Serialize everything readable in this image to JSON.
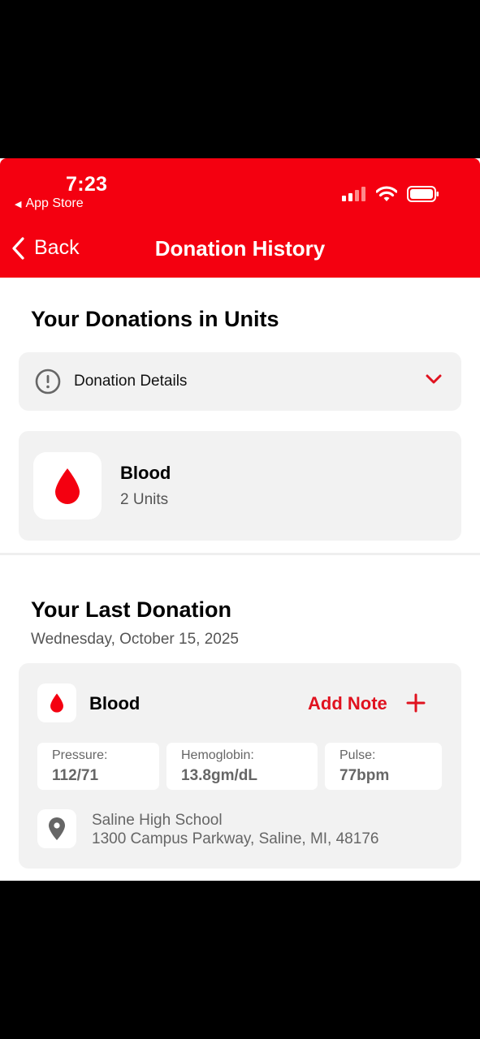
{
  "status_bar": {
    "time": "7:23",
    "back_app": "App Store"
  },
  "nav": {
    "back_label": "Back",
    "title": "Donation History"
  },
  "units_section": {
    "title": "Your Donations in Units",
    "details_label": "Donation Details",
    "item": {
      "type": "Blood",
      "units": "2 Units"
    }
  },
  "last_donation": {
    "title": "Your Last Donation",
    "date": "Wednesday, October 15, 2025",
    "type": "Blood",
    "add_note_label": "Add Note",
    "metrics": [
      {
        "label": "Pressure:",
        "value": "112/71"
      },
      {
        "label": "Hemoglobin:",
        "value": "13.8gm/dL"
      },
      {
        "label": "Pulse:",
        "value": "77bpm"
      }
    ],
    "location": {
      "name": "Saline High School",
      "address": "1300 Campus Parkway, Saline, MI, 48176"
    }
  },
  "colors": {
    "brand_red": "#f40010",
    "accent_red": "#e0121f",
    "card_bg": "#f2f2f2"
  }
}
